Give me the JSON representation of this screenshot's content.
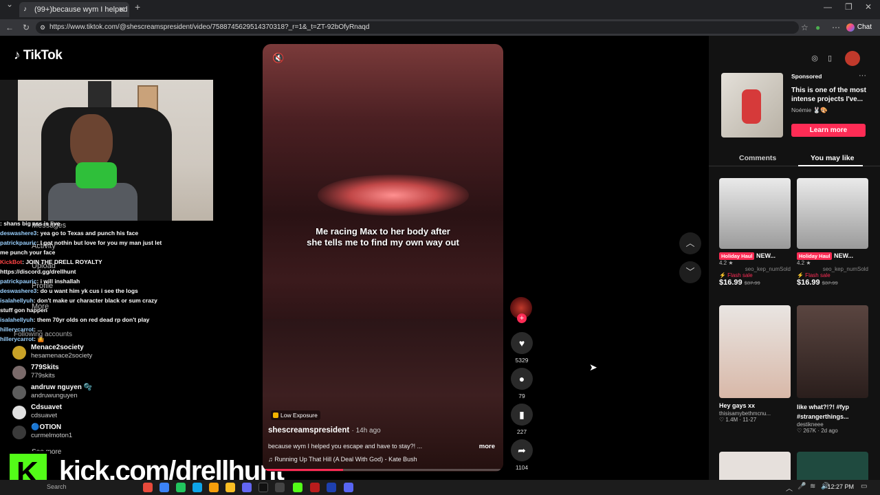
{
  "browser": {
    "tab_title": "(99+)because wym I helped you e…",
    "tab_close": "✕",
    "new_tab": "+",
    "url": "https://www.tiktok.com/@shescreamspresident/video/7588745629514370318?_r=1&_t=ZT-92bOfyRnaqd",
    "chat_label": "Chat",
    "window_minimize": "—",
    "window_restore": "❐",
    "window_close": "✕"
  },
  "tiktok": {
    "logo_text": "TikTok",
    "nav": [
      "Messages",
      "Activity",
      "Upload",
      "Profile",
      "More"
    ],
    "following_label": "Following accounts",
    "accounts": [
      {
        "name": "Menace2society",
        "handle": "hesamenace2society"
      },
      {
        "name": "779Skits",
        "handle": "779skits"
      },
      {
        "name": "andruw nguyen 🫧",
        "handle": "andruwunguyen"
      },
      {
        "name": "Cdsuavet",
        "handle": "cdsuavet"
      },
      {
        "name": "🔵OTION",
        "handle": "curmelmoton1"
      }
    ],
    "see_more": "See more"
  },
  "stream_chat": [
    {
      "user": "",
      "msg": ": shans big ass is live"
    },
    {
      "user": "deswashere3",
      "msg": ": yea go to Texas and punch his face"
    },
    {
      "user": "patrickpauric",
      "msg": ": I got nothin but love for you my man just let me punch your face"
    },
    {
      "user": "KickBot",
      "msg": ": JOIN THE DRELL ROYALTY",
      "red": true
    },
    {
      "user": "",
      "msg": "https://discord.gg/drellhunt"
    },
    {
      "user": "patrickpauric",
      "msg": ": i will inshallah"
    },
    {
      "user": "deswashere3",
      "msg": ": do u want him yk cus i see the logs"
    },
    {
      "user": "isalahellyuh",
      "msg": ": don't make ur character black or sum crazy stuff gon happen"
    },
    {
      "user": "isalahellyuh",
      "msg": ": them 70yr olds on red dead rp don't play"
    },
    {
      "user": "hillerycarrot",
      "msg": ": ..."
    },
    {
      "user": "hillerycarrot",
      "msg": ": 🤷"
    }
  ],
  "kick": {
    "logo_letter": "K",
    "url_text": "kick.com/drellhunt"
  },
  "video": {
    "caption_line1": "Me racing Max to her body after",
    "caption_line2": "she tells me to find my own way out",
    "badge": "Low Exposure",
    "author": "shescreamspresident",
    "time_ago": "· 14h ago",
    "description": "because wym I helped you escape and have to stay?! ...",
    "more": "more",
    "music": "Running Up That Hill (A Deal With God) - Kate Bush",
    "progress": 0.33,
    "likes": "5329",
    "comments": "79",
    "saves": "227",
    "shares": "1104"
  },
  "sponsored": {
    "label": "Sponsored",
    "title": "This is one of the most intense projects I've...",
    "author": "Noémie 🐰🎨",
    "cta": "Learn more",
    "menu": "···"
  },
  "tabs": {
    "comments": "Comments",
    "you_may_like": "You may like"
  },
  "recommendations": [
    {
      "tag": "Holiday Haul",
      "title": "NEW...",
      "rating": "4.2 ★",
      "seller": "seo_kep_numSold",
      "flash": "⚡ Flash sale",
      "price": "$16.99",
      "old_price": "$37.99"
    },
    {
      "tag": "Holiday Haul",
      "title": "NEW...",
      "rating": "4.2 ★",
      "seller": "seo_kep_numSold",
      "flash": "⚡ Flash sale",
      "price": "$16.99",
      "old_price": "$37.99"
    },
    {
      "title": "Hey gays xx",
      "author": "thisisamybethmcnu...",
      "likes": "♡ 1.4M",
      "date": "· 11-27"
    },
    {
      "title": "like what?!?! #fyp #strangerthings...",
      "author": "destikneee",
      "likes": "♡ 267K",
      "date": "· 2d ago"
    }
  ],
  "taskbar": {
    "time": "12:27 PM",
    "search": "Search"
  },
  "icons": {
    "mute": "mute-icon",
    "like": "heart-icon",
    "comment": "comment-icon",
    "save": "bookmark-icon",
    "share": "share-icon",
    "up": "chevron-up-icon",
    "down": "chevron-down-icon"
  },
  "colors": {
    "accent": "#fe2c55",
    "kick_green": "#53fc18"
  }
}
